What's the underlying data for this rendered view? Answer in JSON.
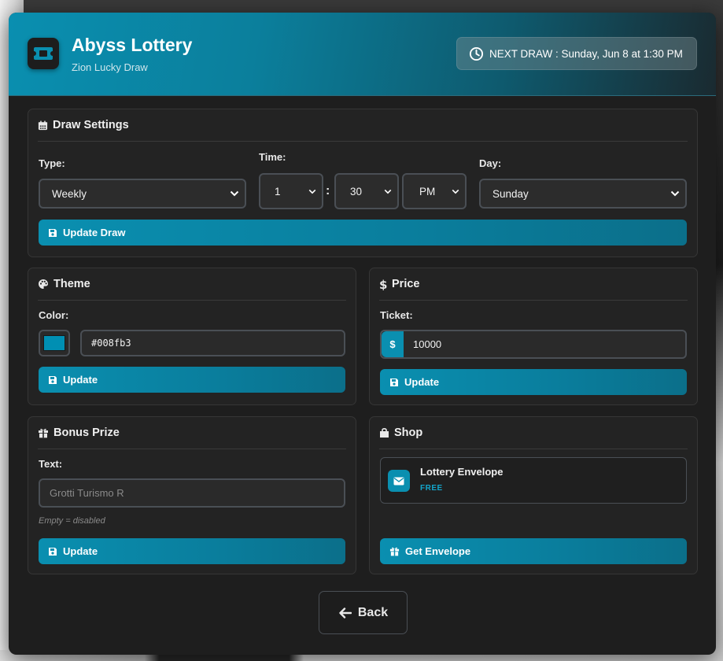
{
  "header": {
    "title": "Abyss Lottery",
    "subtitle": "Zion Lucky Draw",
    "next_draw": "NEXT DRAW : Sunday, Jun 8 at 1:30 PM"
  },
  "draw_settings": {
    "title": "Draw Settings",
    "type_label": "Type:",
    "type_value": "Weekly",
    "time_label": "Time:",
    "hour_value": "1",
    "time_separator": ":",
    "minute_value": "30",
    "ampm_value": "PM",
    "day_label": "Day:",
    "day_value": "Sunday",
    "update_button": "Update Draw"
  },
  "theme": {
    "title": "Theme",
    "color_label": "Color:",
    "color_value": "#008fb3",
    "update_button": "Update"
  },
  "price": {
    "title": "Price",
    "ticket_label": "Ticket:",
    "currency_prefix": "$",
    "ticket_value": "10000",
    "update_button": "Update"
  },
  "bonus_prize": {
    "title": "Bonus Prize",
    "text_label": "Text:",
    "text_placeholder": "Grotti Turismo R",
    "hint": "Empty = disabled",
    "update_button": "Update"
  },
  "shop": {
    "title": "Shop",
    "items": [
      {
        "name": "Lottery Envelope",
        "price": "FREE"
      }
    ],
    "get_button": "Get Envelope"
  },
  "footer": {
    "back_button": "Back"
  },
  "colors": {
    "accent": "#0a8fb0",
    "theme_swatch": "#008fb3",
    "panel_bg": "#1e1e1e"
  },
  "icons": {
    "logo": "ticket-icon",
    "next_draw": "clock-icon",
    "draw_settings": "calendar-icon",
    "theme": "palette-icon",
    "price": "dollar-icon",
    "bonus_prize": "gift-icon",
    "shop": "shopping-bag-icon",
    "save": "save-icon",
    "envelope": "envelope-icon",
    "back": "arrow-left-icon"
  }
}
